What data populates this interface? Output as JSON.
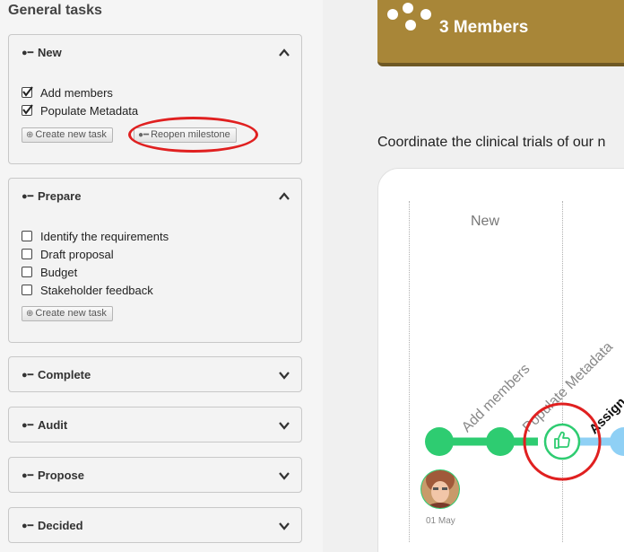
{
  "sidebar": {
    "title": "General tasks",
    "panels": [
      {
        "name": "New",
        "expanded": true,
        "tasks": [
          {
            "label": "Add members",
            "checked": true
          },
          {
            "label": "Populate Metadata",
            "checked": true
          }
        ],
        "buttons": [
          "Create new task",
          "Reopen milestone"
        ]
      },
      {
        "name": "Prepare",
        "expanded": true,
        "tasks": [
          {
            "label": "Identify the requirements",
            "checked": false
          },
          {
            "label": "Draft proposal",
            "checked": false
          },
          {
            "label": "Budget",
            "checked": false
          },
          {
            "label": "Stakeholder feedback",
            "checked": false
          }
        ],
        "buttons": [
          "Create new task"
        ]
      },
      {
        "name": "Complete",
        "expanded": false
      },
      {
        "name": "Audit",
        "expanded": false
      },
      {
        "name": "Propose",
        "expanded": false
      },
      {
        "name": "Decided",
        "expanded": false
      }
    ]
  },
  "main": {
    "members_banner": "3 Members",
    "description": "Coordinate the clinical trials of our n",
    "timeline": {
      "phase": "New",
      "milestones": [
        "Add members",
        "Populate Metadata",
        "Assign"
      ],
      "date": "01 May"
    }
  },
  "colors": {
    "accent_green": "#2ecc71",
    "pending_blue": "#8fd0f5",
    "banner_gold": "#a88638",
    "annotation_red": "#e02020"
  }
}
